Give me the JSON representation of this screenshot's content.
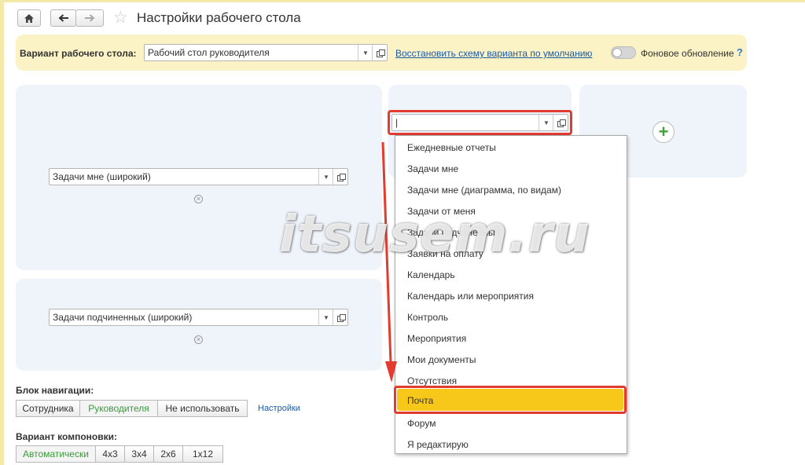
{
  "header": {
    "title": "Настройки рабочего стола",
    "home_icon": "home-icon",
    "back_icon": "arrow-left-icon",
    "forward_icon": "arrow-right-icon",
    "favorite_icon": "star-icon"
  },
  "variant_panel": {
    "label": "Вариант рабочего стола:",
    "value": "Рабочий стол руководителя",
    "restore_link": "Восстановить схему варианта по умолчанию",
    "toggle_label": "Фоновое обновление",
    "help": "?"
  },
  "zones": {
    "left_top_field": "Задачи мне (широкий)",
    "left_bottom_field": "Задачи подчиненных (широкий)",
    "middle_field": "|"
  },
  "dropdown": {
    "items": [
      "Ежедневные отчеты",
      "Задачи мне",
      "Задачи мне (диаграмма, по видам)",
      "Задачи от меня",
      "Задачи подчиненных",
      "Заявки на оплату",
      "Календарь",
      "Календарь или мероприятия",
      "Контроль",
      "Мероприятия",
      "Мои документы",
      "Отсутствия",
      "Почта",
      "Форум",
      "Я редактирую"
    ],
    "highlighted": "Почта"
  },
  "navigation_block": {
    "label": "Блок навигации:",
    "options": [
      "Сотрудника",
      "Руководителя",
      "Не использовать"
    ],
    "selected": "Руководителя",
    "settings_link": "Настройки"
  },
  "layout_variant": {
    "label": "Вариант компоновки:",
    "options": [
      "Автоматически",
      "4x3",
      "3x4",
      "2x6",
      "1x12"
    ],
    "selected": "Автоматически"
  },
  "watermark": "itsusem.ru",
  "colors": {
    "accent_highlight": "#f7c81a",
    "annotation_red": "#e23b2f",
    "panel_yellow": "#fbf2c6",
    "zone_blue": "#eff4fb",
    "link_blue": "#1a5ba8",
    "selected_green": "#3a9a3a"
  }
}
